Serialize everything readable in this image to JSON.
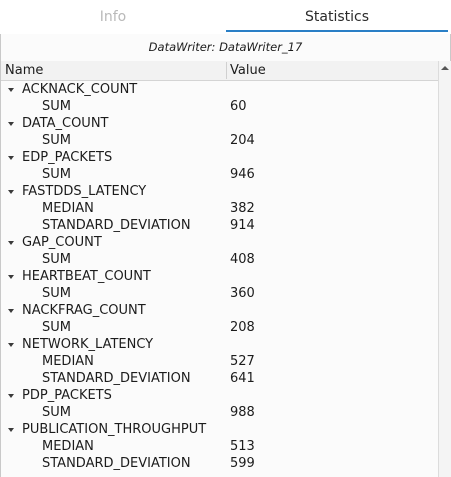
{
  "tabs": {
    "info": "Info",
    "statistics": "Statistics"
  },
  "subtitle": "DataWriter: DataWriter_17",
  "columns": {
    "name": "Name",
    "value": "Value"
  },
  "rows": [
    {
      "kind": "parent",
      "label": "ACKNACK_COUNT",
      "value": ""
    },
    {
      "kind": "child",
      "label": "SUM",
      "value": "60"
    },
    {
      "kind": "parent",
      "label": "DATA_COUNT",
      "value": ""
    },
    {
      "kind": "child",
      "label": "SUM",
      "value": "204"
    },
    {
      "kind": "parent",
      "label": "EDP_PACKETS",
      "value": ""
    },
    {
      "kind": "child",
      "label": "SUM",
      "value": "946"
    },
    {
      "kind": "parent",
      "label": "FASTDDS_LATENCY",
      "value": ""
    },
    {
      "kind": "child",
      "label": "MEDIAN",
      "value": "382"
    },
    {
      "kind": "child",
      "label": "STANDARD_DEVIATION",
      "value": "914"
    },
    {
      "kind": "parent",
      "label": "GAP_COUNT",
      "value": ""
    },
    {
      "kind": "child",
      "label": "SUM",
      "value": "408"
    },
    {
      "kind": "parent",
      "label": "HEARTBEAT_COUNT",
      "value": ""
    },
    {
      "kind": "child",
      "label": "SUM",
      "value": "360"
    },
    {
      "kind": "parent",
      "label": "NACKFRAG_COUNT",
      "value": ""
    },
    {
      "kind": "child",
      "label": "SUM",
      "value": "208"
    },
    {
      "kind": "parent",
      "label": "NETWORK_LATENCY",
      "value": ""
    },
    {
      "kind": "child",
      "label": "MEDIAN",
      "value": "527"
    },
    {
      "kind": "child",
      "label": "STANDARD_DEVIATION",
      "value": "641"
    },
    {
      "kind": "parent",
      "label": "PDP_PACKETS",
      "value": ""
    },
    {
      "kind": "child",
      "label": "SUM",
      "value": "988"
    },
    {
      "kind": "parent",
      "label": "PUBLICATION_THROUGHPUT",
      "value": ""
    },
    {
      "kind": "child",
      "label": "MEDIAN",
      "value": "513"
    },
    {
      "kind": "child",
      "label": "STANDARD_DEVIATION",
      "value": "599"
    }
  ],
  "colors": {
    "accent": "#2a7fc6"
  }
}
